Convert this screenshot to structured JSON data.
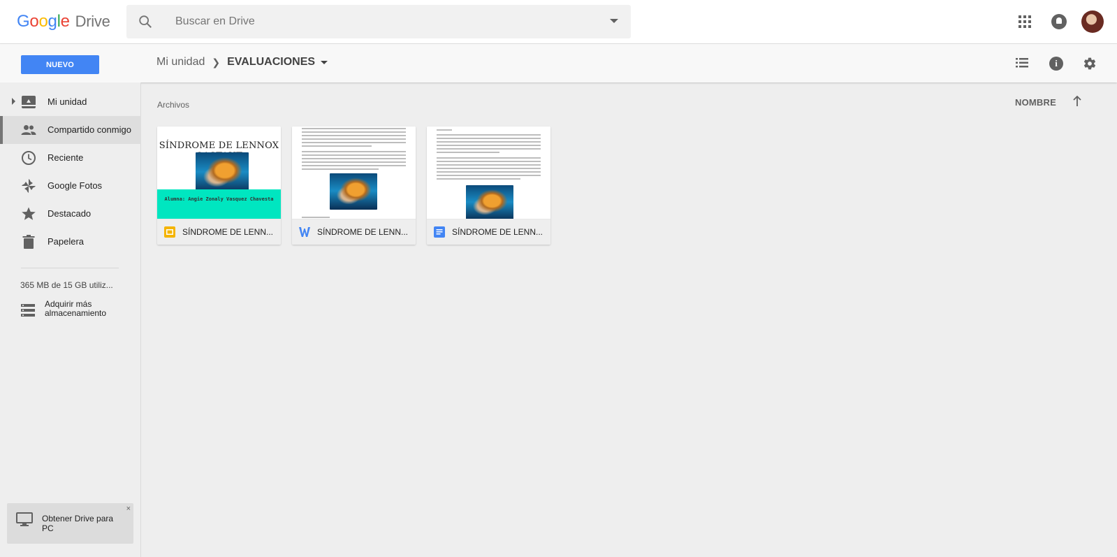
{
  "app": {
    "logo_google": "Google",
    "logo_product": "Drive"
  },
  "search": {
    "placeholder": "Buscar en Drive"
  },
  "toolbar": {
    "new_label": "NUEVO"
  },
  "breadcrumb": {
    "root": "Mi unidad",
    "current": "EVALUACIONES"
  },
  "sidebar": {
    "items": [
      {
        "label": "Mi unidad",
        "icon": "drive-icon"
      },
      {
        "label": "Compartido conmigo",
        "icon": "people-icon",
        "active": true
      },
      {
        "label": "Reciente",
        "icon": "clock-icon"
      },
      {
        "label": "Google Fotos",
        "icon": "pinwheel-icon"
      },
      {
        "label": "Destacado",
        "icon": "star-icon"
      },
      {
        "label": "Papelera",
        "icon": "trash-icon"
      }
    ],
    "storage_text": "365 MB de 15 GB utiliz...",
    "storage_link": "Adquirir más almacenamiento",
    "promo": {
      "label": "Obtener Drive para PC",
      "close": "×"
    }
  },
  "main": {
    "heading": "Archivos",
    "sort_label": "NOMBRE",
    "files": [
      {
        "name": "SÍNDROME DE LENN...",
        "type": "slides",
        "thumb_title": "SÍNDROME DE LENNOX GASTAUT",
        "thumb_student": "Alumna: Angie Zonaly Vasquez Chavesta"
      },
      {
        "name": "SÍNDROME DE LENN...",
        "type": "word"
      },
      {
        "name": "SÍNDROME DE LENN...",
        "type": "docs"
      }
    ]
  },
  "colors": {
    "accent": "#4285f4",
    "slides": "#f4b400",
    "docs": "#4285f4",
    "band": "#00e6c0"
  }
}
